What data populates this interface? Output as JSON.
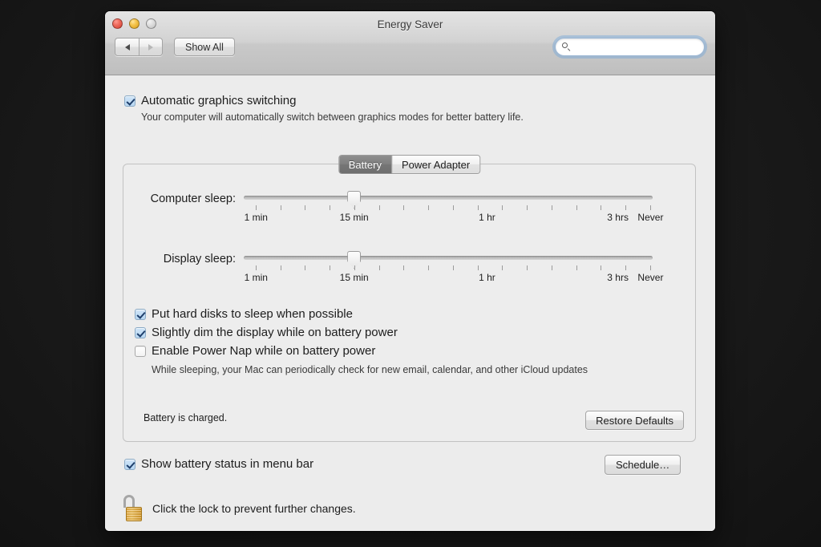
{
  "window": {
    "title": "Energy Saver",
    "traffic_lights": [
      "close-button",
      "minimize-button",
      "zoom-button"
    ]
  },
  "toolbar": {
    "back_label": "◀",
    "forward_label": "▶",
    "show_all_label": "Show All",
    "search_placeholder": "",
    "search_value": "",
    "search_icon": "search-icon"
  },
  "graphics": {
    "checked": true,
    "label": "Automatic graphics switching",
    "description": "Your computer will automatically switch between graphics modes for better battery life."
  },
  "tabs": [
    {
      "label": "Battery",
      "selected": true
    },
    {
      "label": "Power Adapter",
      "selected": false
    }
  ],
  "sliders": [
    {
      "label": "Computer sleep:",
      "value": "15 min",
      "thumb_percent": 27,
      "tick_count": 17,
      "tick_labels": [
        {
          "text": "1 min",
          "percent": 3
        },
        {
          "text": "15 min",
          "percent": 27
        },
        {
          "text": "1 hr",
          "percent": 59.5
        },
        {
          "text": "3 hrs",
          "percent": 91.5
        },
        {
          "text": "Never",
          "percent": 99.5
        }
      ]
    },
    {
      "label": "Display sleep:",
      "value": "15 min",
      "thumb_percent": 27,
      "tick_count": 17,
      "tick_labels": [
        {
          "text": "1 min",
          "percent": 3
        },
        {
          "text": "15 min",
          "percent": 27
        },
        {
          "text": "1 hr",
          "percent": 59.5
        },
        {
          "text": "3 hrs",
          "percent": 91.5
        },
        {
          "text": "Never",
          "percent": 99.5
        }
      ]
    }
  ],
  "options": [
    {
      "checked": true,
      "label": "Put hard disks to sleep when possible"
    },
    {
      "checked": true,
      "label": "Slightly dim the display while on battery power"
    },
    {
      "checked": false,
      "label": "Enable Power Nap while on battery power"
    }
  ],
  "power_nap_description": "While sleeping, your Mac can periodically check for new email, calendar, and other iCloud updates",
  "status_text": "Battery is charged.",
  "restore_defaults_label": "Restore Defaults",
  "menu_bar_option": {
    "checked": true,
    "label": "Show battery status in menu bar"
  },
  "schedule_label": "Schedule…",
  "lock": {
    "icon": "unlocked-padlock-icon",
    "text": "Click the lock to prevent further changes."
  },
  "help_label": "?",
  "colors": {
    "desktop": "#1b1b1b",
    "window_bg": "#ececec",
    "accent_blue": "#b8d7f2",
    "check_mark": "#1f3f6b",
    "lock_gold": "#e8ae45",
    "selected_tab": "#7e7e7e"
  }
}
